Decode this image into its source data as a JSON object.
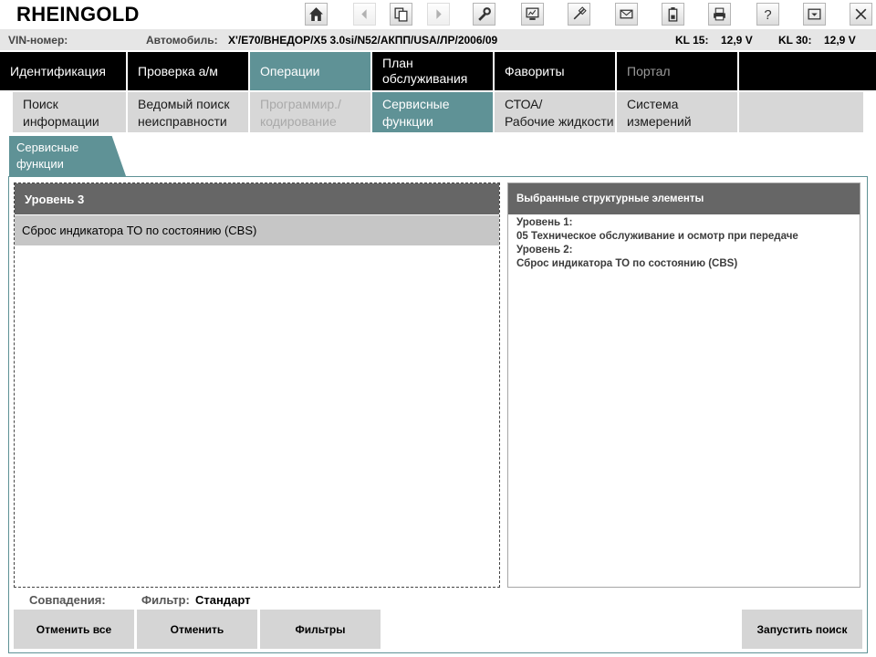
{
  "app": {
    "title": "RHEINGOLD"
  },
  "toolbar": [
    {
      "name": "home-icon",
      "enabled": true
    },
    {
      "name": "back-icon",
      "enabled": false
    },
    {
      "name": "clipboard-copy-icon",
      "enabled": true
    },
    {
      "name": "forward-icon",
      "enabled": false
    },
    {
      "name": "wrench-icon",
      "enabled": true
    },
    {
      "name": "diagnostic-chart-icon",
      "enabled": true
    },
    {
      "name": "connection-plug-icon",
      "enabled": true
    },
    {
      "name": "mail-icon",
      "enabled": true
    },
    {
      "name": "battery-icon",
      "enabled": true
    },
    {
      "name": "printer-icon",
      "enabled": true
    },
    {
      "name": "help-icon",
      "enabled": true
    },
    {
      "name": "minimize-icon",
      "enabled": true
    },
    {
      "name": "close-icon",
      "enabled": true
    }
  ],
  "info": {
    "vin_label": "VIN-номер:",
    "car_label": "Автомобиль:",
    "car_value": "X'/E70/ВНЕДОР/X5 3.0si/N52/АКПП/USA/ЛР/2006/09",
    "kl15_label": "KL 15:",
    "kl15_value": "12,9 V",
    "kl30_label": "KL 30:",
    "kl30_value": "12,9 V"
  },
  "main_tabs": [
    {
      "line1": "Идентификация",
      "line2": "",
      "state": "normal"
    },
    {
      "line1": "Проверка а/м",
      "line2": "",
      "state": "normal"
    },
    {
      "line1": "Операции",
      "line2": "",
      "state": "active"
    },
    {
      "line1": "План",
      "line2": "обслуживания",
      "state": "normal"
    },
    {
      "line1": "Фавориты",
      "line2": "",
      "state": "normal"
    },
    {
      "line1": "Портал",
      "line2": "",
      "state": "disabled"
    }
  ],
  "sub_tabs": [
    {
      "line1": "Поиск",
      "line2": "информации",
      "state": "normal"
    },
    {
      "line1": "Ведомый поиск",
      "line2": "неисправности",
      "state": "normal"
    },
    {
      "line1": "Программир./",
      "line2": "кодирование",
      "state": "disabled"
    },
    {
      "line1": "Сервисные",
      "line2": "функции",
      "state": "active"
    },
    {
      "line1": "СТОА/",
      "line2": "Рабочие жидкости",
      "state": "normal"
    },
    {
      "line1": "Система",
      "line2": "измерений",
      "state": "normal"
    }
  ],
  "section": {
    "line1": "Сервисные",
    "line2": "функции"
  },
  "left_panel": {
    "header": "Уровень 3",
    "rows": [
      "Сброс индикатора ТО по состоянию (CBS)"
    ]
  },
  "right_panel": {
    "header": "Выбранные структурные элементы",
    "lines": [
      "Уровень 1:",
      "05 Техническое обслуживание и осмотр при передаче",
      "Уровень 2:",
      "Сброс индикатора ТО по состоянию (CBS)"
    ]
  },
  "footer": {
    "matches_label": "Совпадения:",
    "filter_label": "Фильтр:",
    "filter_value": "Стандарт",
    "cancel_all": "Отменить все",
    "cancel": "Отменить",
    "filters": "Фильтры",
    "start_search": "Запустить поиск"
  },
  "colors": {
    "accent": "#5f9296",
    "nav_bg": "#000000",
    "header_bg": "#666666",
    "selected_row": "#c6c6c6"
  }
}
